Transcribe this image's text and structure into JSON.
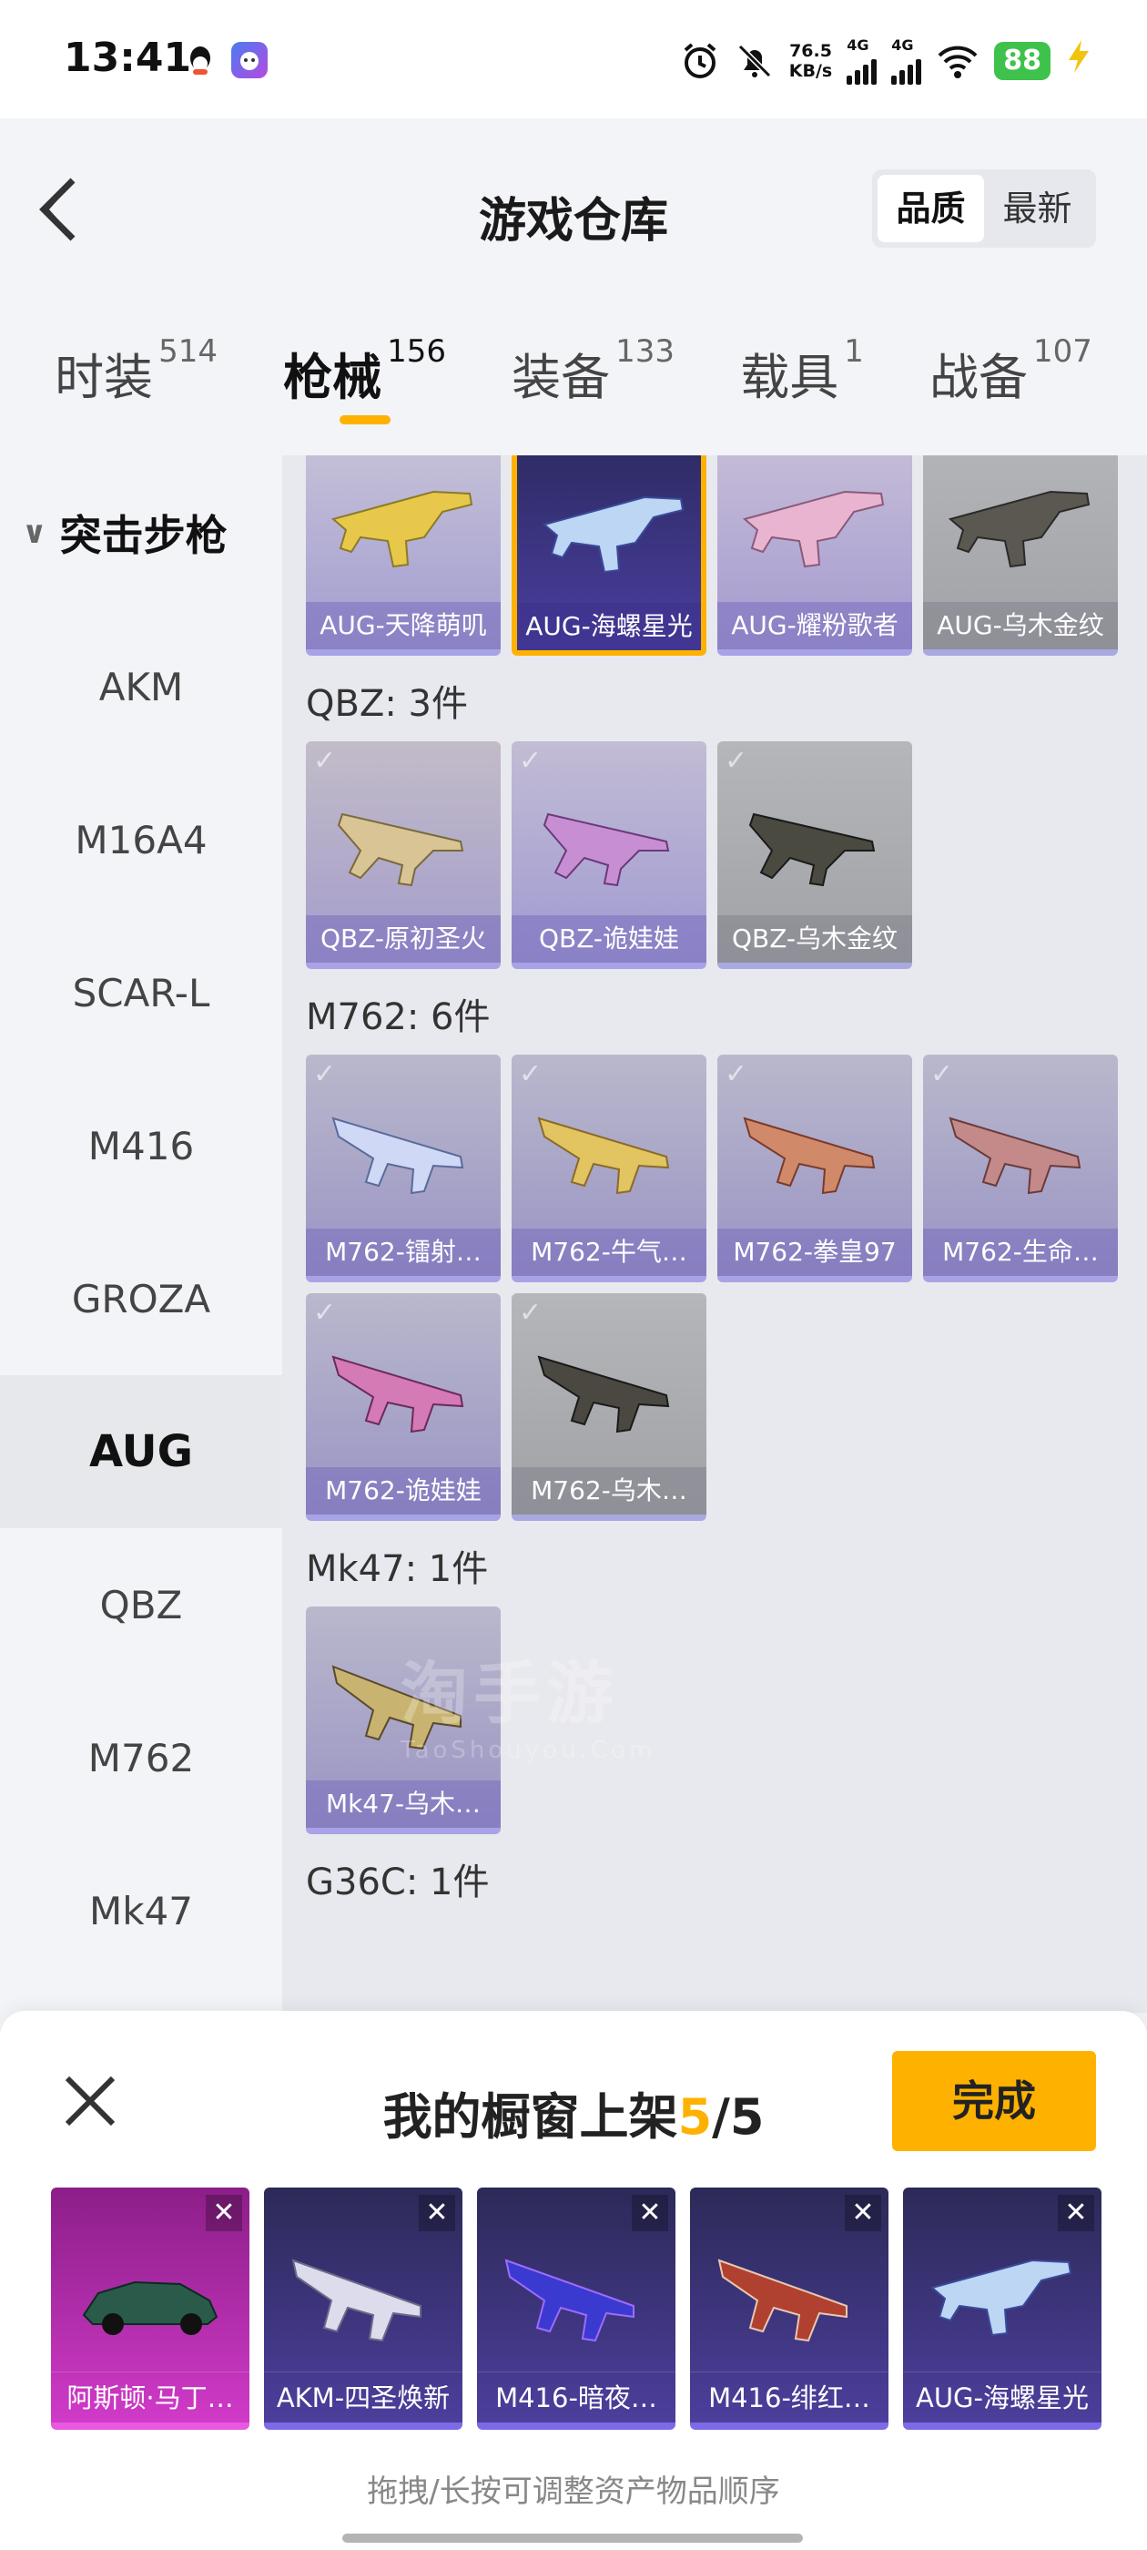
{
  "status_bar": {
    "time": "13:41",
    "speed_value": "76.5",
    "speed_unit": "KB/s",
    "net1": "4G",
    "net2": "4G",
    "battery": "88",
    "icons": [
      "qq-icon",
      "game-app-icon",
      "alarm-icon",
      "mute-icon",
      "signal-icon",
      "wifi-icon",
      "charging-icon"
    ]
  },
  "header": {
    "title": "游戏仓库",
    "sort_options": [
      "品质",
      "最新"
    ],
    "sort_selected": "品质"
  },
  "tabs": [
    {
      "label": "时装",
      "count": "514"
    },
    {
      "label": "枪械",
      "count": "156",
      "active": true
    },
    {
      "label": "装备",
      "count": "133"
    },
    {
      "label": "载具",
      "count": "1"
    },
    {
      "label": "战备",
      "count": "107"
    }
  ],
  "sidebar": {
    "category": "突击步枪",
    "items": [
      "AKM",
      "M16A4",
      "SCAR-L",
      "M416",
      "GROZA",
      "AUG",
      "QBZ",
      "M762",
      "Mk47"
    ],
    "active": "AUG"
  },
  "content": {
    "aug_items": [
      "AUG-天降萌叽",
      "AUG-海螺星光",
      "AUG-耀粉歌者",
      "AUG-乌木金纹"
    ],
    "qbz": {
      "title": "QBZ: 3件",
      "items": [
        "QBZ-原初圣火",
        "QBZ-诡娃娃",
        "QBZ-乌木金纹"
      ]
    },
    "m762": {
      "title": "M762: 6件",
      "items": [
        "M762-镭射…",
        "M762-牛气…",
        "M762-拳皇97",
        "M762-生命…",
        "M762-诡娃娃",
        "M762-乌木…"
      ]
    },
    "mk47": {
      "title": "Mk47: 1件",
      "items": [
        "Mk47-乌木…"
      ]
    },
    "next_title_partial": "G36C: 1件",
    "watermark": "淘手游",
    "watermark_sub": "TaoShouyou.Com"
  },
  "sheet": {
    "title_prefix": "我的橱窗上架",
    "count": "5",
    "total": "/5",
    "done_label": "完成",
    "shelf_items": [
      "阿斯顿·马丁…",
      "AKM-四圣焕新",
      "M416-暗夜…",
      "M416-绯红…",
      "AUG-海螺星光"
    ],
    "hint": "拖拽/长按可调整资产物品顺序"
  },
  "colors": {
    "accent": "#ffb100",
    "card_purple": "#9a94c4",
    "card_grey": "#a0a2a6"
  }
}
